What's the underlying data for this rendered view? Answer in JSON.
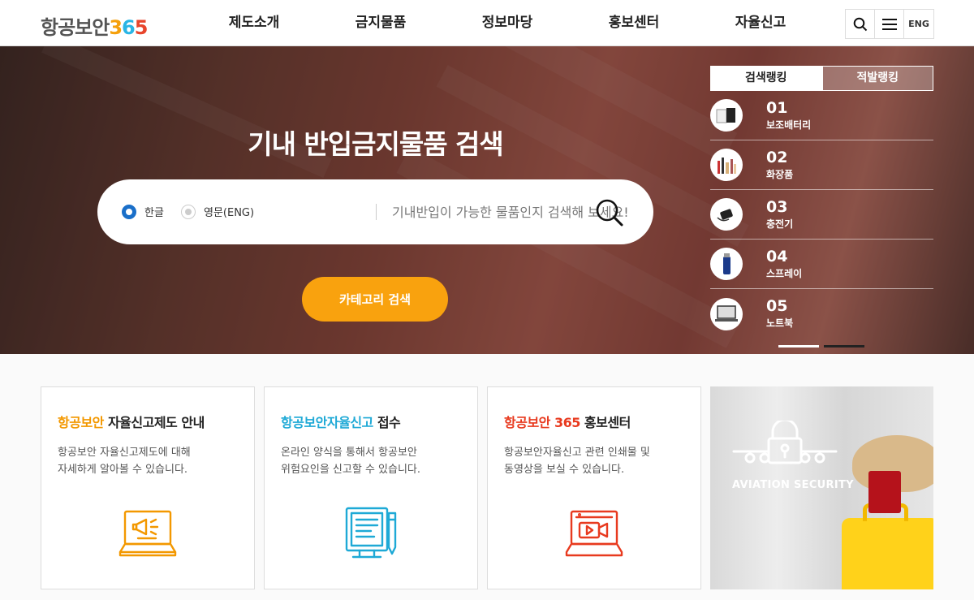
{
  "header": {
    "logo_text": "항공보안",
    "logo_3": "3",
    "logo_6": "6",
    "logo_5": "5",
    "nav": [
      "제도소개",
      "금지물품",
      "정보마당",
      "홍보센터",
      "자율신고"
    ],
    "search_icon": "search-icon",
    "menu_icon": "menu-icon",
    "lang": "ENG"
  },
  "hero": {
    "title": "기내 반입금지물품 검색",
    "radio_korean": "한글",
    "radio_english": "영문(ENG)",
    "search_placeholder": "기내반입이 가능한 물품인지 검색해 보세요!",
    "category_button": "카테고리 검색"
  },
  "ranking": {
    "tabs": [
      "검색랭킹",
      "적발랭킹"
    ],
    "items": [
      {
        "num": "01",
        "name": "보조배터리",
        "icon": "battery-icon"
      },
      {
        "num": "02",
        "name": "화장품",
        "icon": "cosmetics-icon"
      },
      {
        "num": "03",
        "name": "충전기",
        "icon": "charger-icon"
      },
      {
        "num": "04",
        "name": "스프레이",
        "icon": "spray-icon"
      },
      {
        "num": "05",
        "name": "노트북",
        "icon": "laptop-icon"
      }
    ]
  },
  "cards": [
    {
      "title_accent": "항공보안",
      "title_rest": " 자율신고제도 안내",
      "accent_color": "#f39800",
      "desc_lines": [
        "항공보안 자율신고제도에 대해",
        "자세하게 알아볼 수 있습니다."
      ],
      "icon": "megaphone-laptop-icon"
    },
    {
      "title_accent": "항공보안자율신고",
      "title_rest": " 접수",
      "accent_color": "#1ea9d6",
      "desc_lines": [
        "온라인 양식을 통해서 항공보안",
        "위험요인을 신고할 수 있습니다."
      ],
      "icon": "document-pen-icon"
    },
    {
      "title_accent": "항공보안 365",
      "title_rest": " 홍보센터",
      "accent_color": "#e83a1f",
      "desc_lines": [
        "항공보안자율신고 관련 인쇄물 및",
        "동영상을 보실 수 있습니다."
      ],
      "icon": "video-laptop-icon"
    }
  ],
  "photo": {
    "text": "AVIATION SECURITY"
  }
}
